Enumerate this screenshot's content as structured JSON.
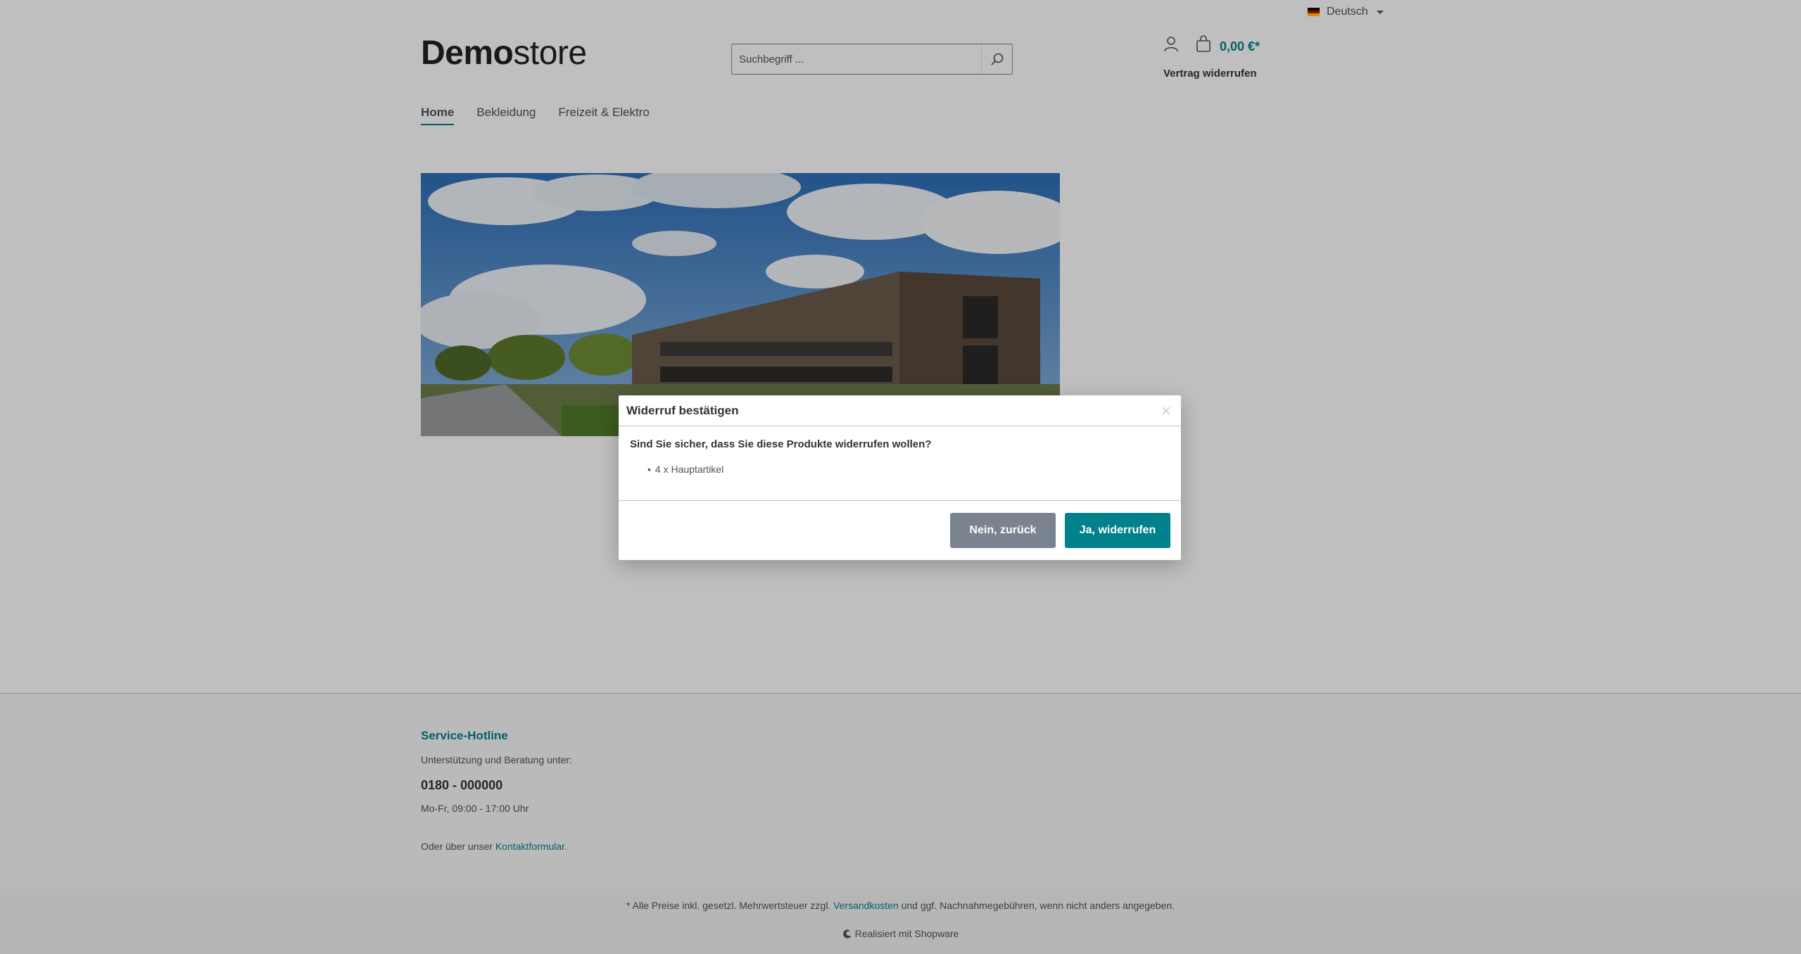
{
  "header": {
    "language": "Deutsch",
    "logo_bold": "Demo",
    "logo_light": "store",
    "search_placeholder": "Suchbegriff ...",
    "cart_total": "0,00 €*",
    "revoke_link": "Vertrag widerrufen"
  },
  "nav": {
    "items": [
      "Home",
      "Bekleidung",
      "Freizeit & Elektro"
    ]
  },
  "footer": {
    "hotline_title": "Service-Hotline",
    "hotline_text": "Unterstützung und Beratung unter:",
    "phone": "0180 - 000000",
    "hours": "Mo-Fr, 09:00 - 17:00 Uhr",
    "contact_prefix": "Oder über unser ",
    "contact_link": "Kontaktformular",
    "contact_suffix": "."
  },
  "bottom": {
    "vat_prefix": "* Alle Preise inkl. gesetzl. Mehrwertsteuer zzgl. ",
    "vat_link": "Versandkosten",
    "vat_suffix": " und ggf. Nachnahmegebühren, wenn nicht anders angegeben.",
    "powered": "Realisiert mit Shopware"
  },
  "modal": {
    "title": "Widerruf bestätigen",
    "question": "Sind Sie sicher, dass Sie diese Produkte widerrufen wollen?",
    "items": [
      "4 x Hauptartikel"
    ],
    "cancel_label": "Nein, zurück",
    "confirm_label": "Ja, widerrufen"
  },
  "colors": {
    "primary": "#00818b",
    "secondary": "#798490",
    "text": "#4a545b"
  }
}
